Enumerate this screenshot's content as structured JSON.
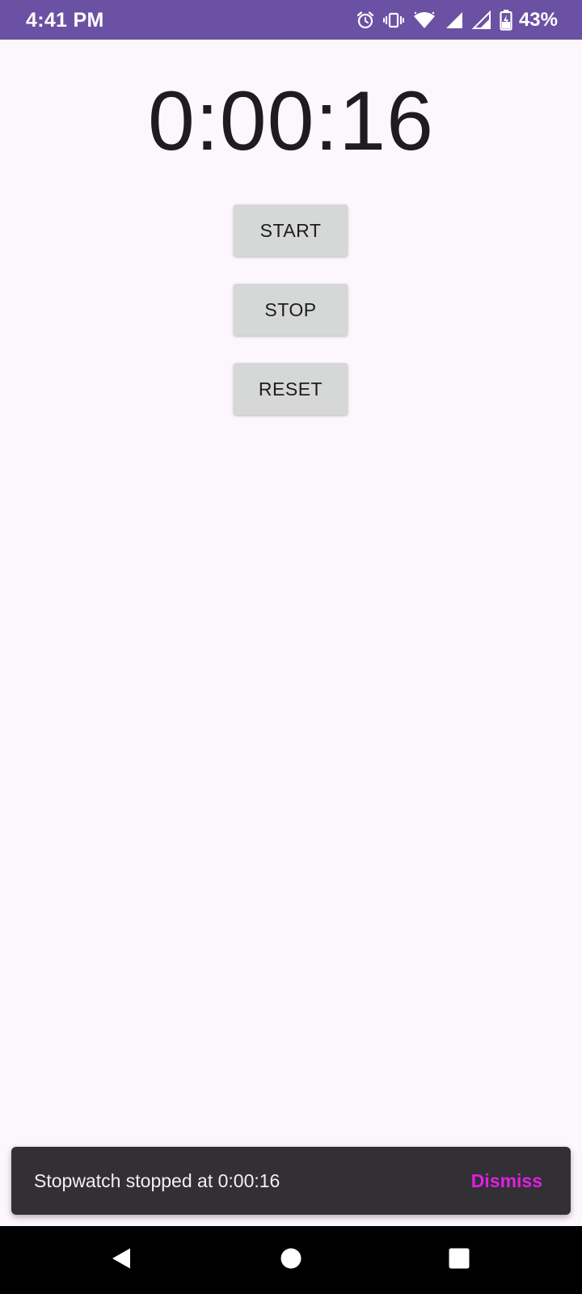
{
  "status_bar": {
    "time": "4:41 PM",
    "battery_percent": "43%",
    "icons": [
      "alarm-icon",
      "vibrate-icon",
      "wifi-icon",
      "signal-icon",
      "signal-icon",
      "battery-charging-icon"
    ],
    "background_color": "#6B51A3"
  },
  "stopwatch": {
    "elapsed": "0:00:16"
  },
  "buttons": {
    "start_label": "START",
    "stop_label": "STOP",
    "reset_label": "RESET"
  },
  "snackbar": {
    "message": "Stopwatch stopped at 0:00:16",
    "action_label": "Dismiss",
    "action_color": "#E020E0"
  },
  "nav_bar": {
    "icons": [
      "back-icon",
      "home-icon",
      "recents-icon"
    ]
  }
}
